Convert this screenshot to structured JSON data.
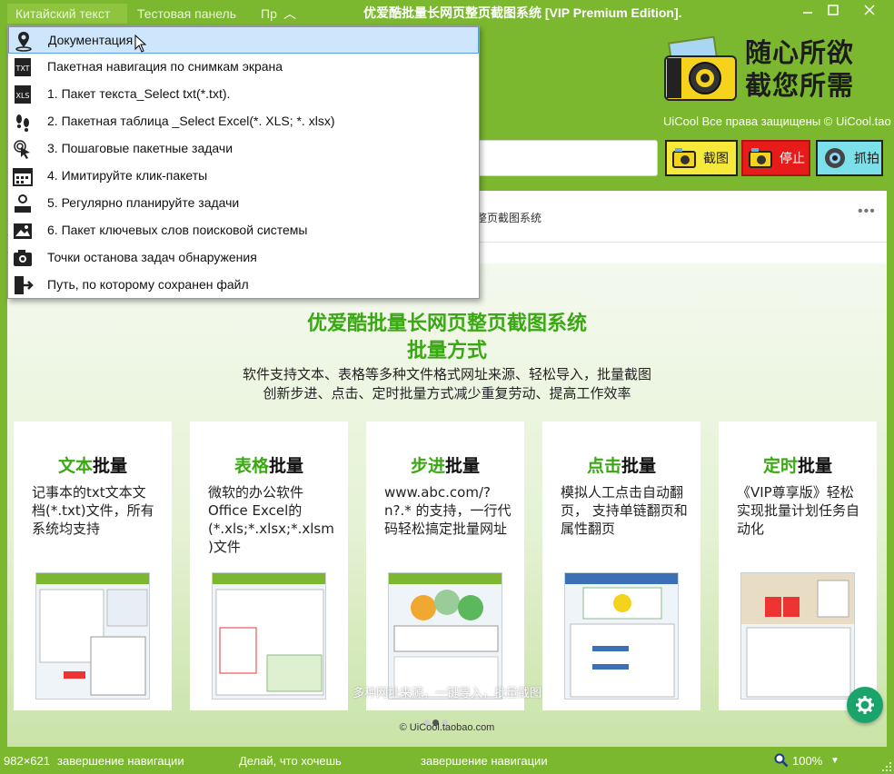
{
  "window": {
    "title": "优爱酷批量长网页整页截图系统 [VIP Premium Edition].",
    "tabs": [
      "Китайский текст",
      "Тестовая панель",
      "Пр"
    ]
  },
  "header": {
    "logo_text": "随心所欲 截您所需",
    "copyright": "UiCool Все права защищены © UiCool.tao"
  },
  "actions": {
    "capture": "截图",
    "stop": "停止",
    "grab": "抓拍"
  },
  "page": {
    "address_text": "整页截图系统",
    "more": "•••"
  },
  "banner": {
    "title1": "优爱酷批量长网页整页截图系统",
    "title2": "批量方式",
    "sub1": "软件支持文本、表格等多种文件格式网址来源、轻松导入，批量截图",
    "sub2": "创新步进、点击、定时批量方式减少重复劳动、提高工作效率",
    "cards": [
      {
        "green": "文本",
        "black": "批量",
        "desc": "记事本的txt文本文档(*.txt)文件，所有系统均支持"
      },
      {
        "green": "表格",
        "black": "批量",
        "desc": "微软的办公软件Office Excel的(*.xls;*.xlsx;*.xlsm)文件"
      },
      {
        "green": "步进",
        "black": "批量",
        "desc": "www.abc.com/?n?.* 的支持，一行代码轻松搞定批量网址"
      },
      {
        "green": "点击",
        "black": "批量",
        "desc": "模拟人工点击自动翻页， 支持单链翻页和属性翻页"
      },
      {
        "green": "定时",
        "black": "批量",
        "desc": "《VIP尊享版》轻松实现批量计划任务自动化"
      }
    ],
    "overlay_caption": "多种网址来源，一键导入，批量截图",
    "copyright": "© UiCool.taobao.com"
  },
  "statusbar": {
    "size": "982×621",
    "status1": "завершение навигации",
    "hint": "Делай, что хочешь",
    "status2": "завершение навигации",
    "zoom": "100%"
  },
  "menu": {
    "items": [
      {
        "label": "Документация",
        "icon": "location-pin-icon"
      },
      {
        "label": "Пакетная навигация по снимкам экрана",
        "icon": "txt-file-icon"
      },
      {
        "label": "1. Пакет текста_Select txt(*.txt).",
        "icon": "txt-file-icon"
      },
      {
        "label": "2. Пакетная таблица _Select Excel(*. XLS; *. xlsx)",
        "icon": "xls-file-icon"
      },
      {
        "label": "3. Пошаговые пакетные задачи",
        "icon": "footprints-icon"
      },
      {
        "label": "4. Имитируйте клик-пакеты",
        "icon": "click-hand-icon"
      },
      {
        "label": "5. Регулярно планируйте задачи",
        "icon": "calendar-icon"
      },
      {
        "label": "6. Пакет ключевых слов поисковой системы",
        "icon": "search-user-icon"
      },
      {
        "label": "Точки останова задач обнаружения",
        "icon": "image-icon"
      },
      {
        "label": "Путь, по которому сохранен файл",
        "icon": "camera-icon"
      },
      {
        "label": "",
        "icon": "exit-icon"
      }
    ]
  }
}
